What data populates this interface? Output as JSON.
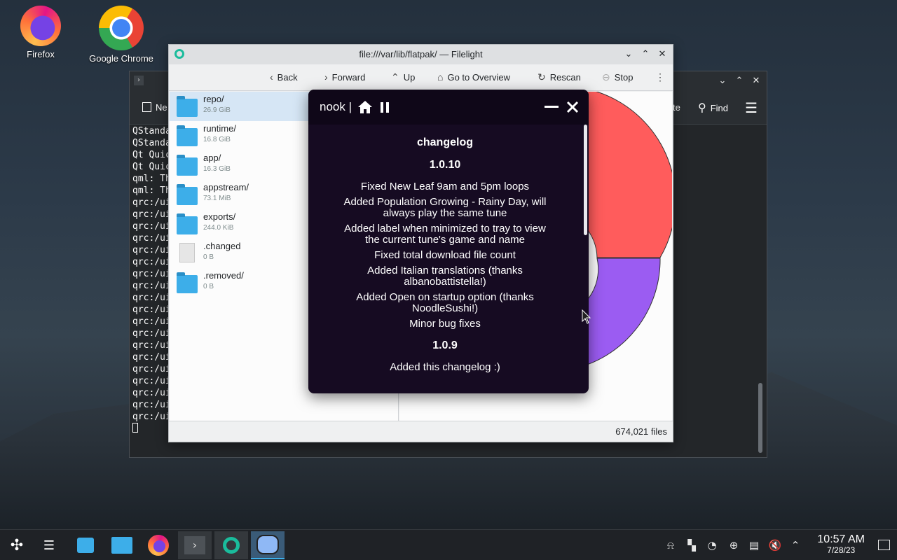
{
  "desktop": {
    "icons": [
      {
        "label": "Firefox",
        "icon": "firefox-icon"
      },
      {
        "label": "Google Chrome",
        "icon": "chrome-icon"
      }
    ]
  },
  "terminal": {
    "toolbar": {
      "new_label_partial": "Ne",
      "paste_partial": "te",
      "find_label": "Find"
    },
    "lines": [
      "QStanda",
      "QStanda",
      "Qt Quic",
      "Qt Quic",
      "qml: Th",
      "qml: Th",
      "qrc:/ui",
      "qrc:/ui",
      "qrc:/ui",
      "qrc:/ui",
      "qrc:/ui",
      "qrc:/ui",
      "qrc:/ui",
      "qrc:/ui",
      "qrc:/ui",
      "qrc:/ui",
      "qrc:/ui",
      "qrc:/ui",
      "qrc:/ui",
      "qrc:/ui",
      "qrc:/ui",
      "qrc:/ui",
      "qrc:/ui",
      "qrc:/ui",
      "qrc:/ui"
    ]
  },
  "filelight": {
    "title": "file:///var/lib/flatpak/ — Filelight",
    "toolbar": {
      "back": "Back",
      "forward": "Forward",
      "up": "Up",
      "overview": "Go to Overview",
      "rescan": "Rescan",
      "stop": "Stop"
    },
    "entries": [
      {
        "name": "repo/",
        "size": "26.9 GiB",
        "type": "folder",
        "selected": true
      },
      {
        "name": "runtime/",
        "size": "16.8 GiB",
        "type": "folder"
      },
      {
        "name": "app/",
        "size": "16.3 GiB",
        "type": "folder"
      },
      {
        "name": "appstream/",
        "size": "73.1 MiB",
        "type": "folder"
      },
      {
        "name": "exports/",
        "size": "244.0 KiB",
        "type": "folder"
      },
      {
        "name": ".changed",
        "size": "0 B",
        "type": "file"
      },
      {
        "name": ".removed/",
        "size": "0 B",
        "type": "folder"
      }
    ],
    "status": "674,021 files",
    "colors": {
      "segment_red": "#ff5c5c",
      "segment_purple": "#9b5cf2"
    }
  },
  "nook": {
    "title": "nook |",
    "changelog_heading": "changelog",
    "versions": [
      {
        "version": "1.0.10",
        "items": [
          "Fixed New Leaf 9am and 5pm loops",
          "Added Population Growing - Rainy Day, will always play the same tune",
          "Added label when minimized to tray to view the current tune's game and name",
          "Fixed total download file count",
          "Added Italian translations (thanks albanobattistella!)",
          "Added Open on startup option (thanks NoodleSushi!)",
          "Minor bug fixes"
        ]
      },
      {
        "version": "1.0.9",
        "items": [
          "Added this changelog :)"
        ]
      }
    ]
  },
  "taskbar": {
    "time": "10:57 AM",
    "date": "7/28/23"
  }
}
